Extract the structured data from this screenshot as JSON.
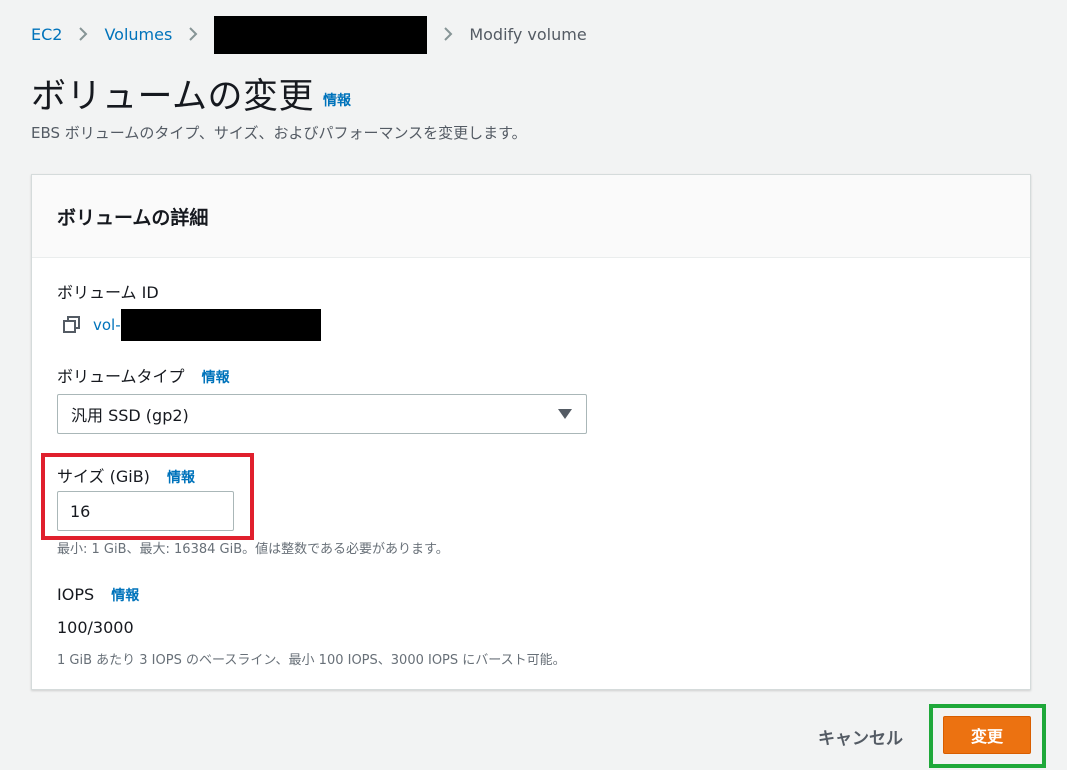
{
  "breadcrumb": {
    "ec2": "EC2",
    "volumes": "Volumes",
    "current": "Modify volume"
  },
  "page": {
    "title": "ボリュームの変更",
    "title_info": "情報",
    "description": "EBS ボリュームのタイプ、サイズ、およびパフォーマンスを変更します。"
  },
  "panel": {
    "title": "ボリュームの詳細",
    "volume_id_label": "ボリューム ID",
    "volume_id_value": "vol-",
    "volume_type_label": "ボリュームタイプ",
    "volume_type_info": "情報",
    "volume_type_value": "汎用 SSD (gp2)",
    "size_label": "サイズ (GiB)",
    "size_info": "情報",
    "size_value": "16",
    "size_hint": "最小: 1 GiB、最大: 16384 GiB。値は整数である必要があります。",
    "iops_label": "IOPS",
    "iops_info": "情報",
    "iops_value": "100/3000",
    "iops_hint": "1 GiB あたり 3 IOPS のベースライン、最小 100 IOPS、3000 IOPS にバースト可能。"
  },
  "footer": {
    "cancel_label": "キャンセル",
    "submit_label": "変更"
  },
  "colors": {
    "link": "#0073bb",
    "primary": "#ec7211",
    "highlight_red": "#e0202d",
    "highlight_green": "#1fa83a"
  },
  "icons": [
    "chevron-right-icon",
    "copy-icon",
    "caret-down-icon"
  ]
}
